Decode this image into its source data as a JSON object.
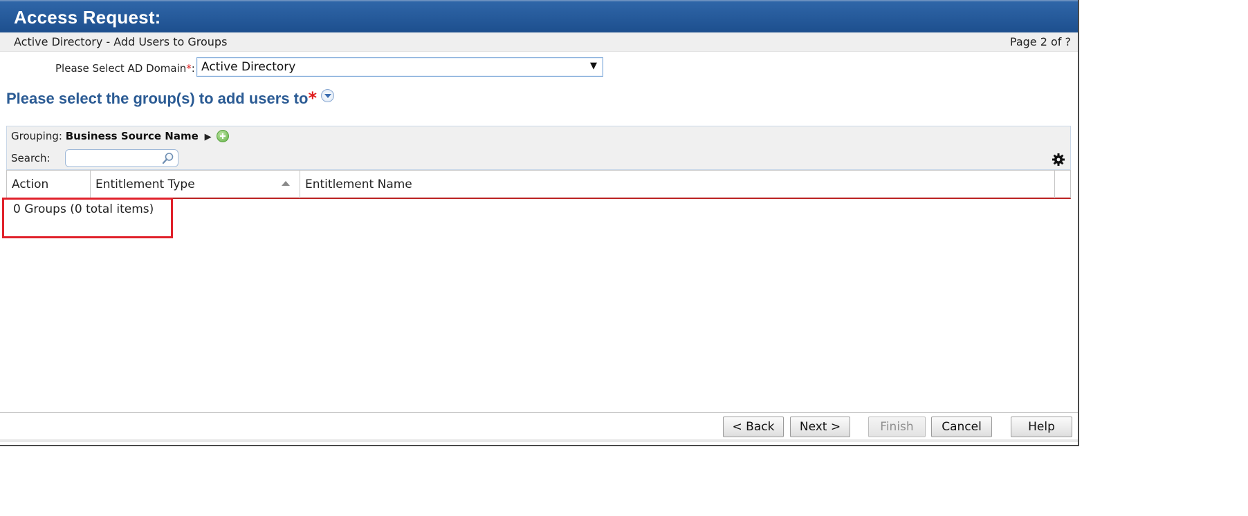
{
  "header": {
    "title": "Access Request:"
  },
  "subheader": {
    "subtitle": "Active Directory - Add Users to Groups",
    "page_indicator": "Page 2 of ?"
  },
  "domain": {
    "label": "Please Select AD Domain",
    "required_mark": "*",
    "colon": ":",
    "selected": "Active Directory",
    "arrow": "▼"
  },
  "section": {
    "heading": "Please select the group(s) to add users to",
    "required_mark": "*"
  },
  "toolbar": {
    "grouping_label": "Grouping:",
    "grouping_value": "Business Source Name",
    "grouping_arrow": "▶",
    "search_label": "Search:",
    "search_value": ""
  },
  "grid": {
    "columns": [
      "Action",
      "Entitlement Type",
      "Entitlement Name"
    ],
    "sorted_column": "Entitlement Type",
    "summary": "0 Groups (0 total items)"
  },
  "footer": {
    "buttons": [
      "< Back",
      "Next >",
      "Finish",
      "Cancel",
      "Help"
    ],
    "disabled": [
      "Finish"
    ]
  },
  "colors": {
    "title_bar": "#1d4f8e",
    "heading": "#2b5b94",
    "required": "#e01c1c",
    "highlight": "#e0202a"
  }
}
